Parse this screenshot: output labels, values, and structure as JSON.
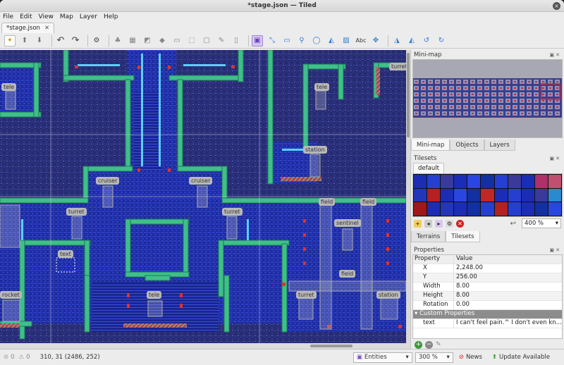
{
  "window": {
    "title": "*stage.json — Tiled"
  },
  "menu": [
    "File",
    "Edit",
    "View",
    "Map",
    "Layer",
    "Help"
  ],
  "document_tab": {
    "label": "*stage.json"
  },
  "toolbar_icons": [
    "new-file-icon",
    "open-file-icon",
    "save-file-icon",
    "undo-icon",
    "redo-icon",
    "command-icon",
    "stamp-brush-icon",
    "terrain-brush-icon",
    "bucket-fill-icon",
    "shape-fill-icon",
    "eraser-icon",
    "rectangle-select-icon",
    "magic-wand-icon",
    "select-same-tile-icon",
    "select-objects-icon",
    "edit-polygons-icon",
    "insert-rectangle-icon",
    "insert-point-icon",
    "insert-ellipse-icon",
    "insert-polygon-icon",
    "insert-tile-icon",
    "insert-text-icon",
    "move-icon",
    "flip-horizontal-icon",
    "flip-vertical-icon",
    "rotate-left-icon",
    "rotate-right-icon"
  ],
  "objects": [
    {
      "label": "tele"
    },
    {
      "label": "tele"
    },
    {
      "label": "turret"
    },
    {
      "label": "station"
    },
    {
      "label": "cruiser"
    },
    {
      "label": "cruiser"
    },
    {
      "label": "turret"
    },
    {
      "label": "turret"
    },
    {
      "label": "field"
    },
    {
      "label": "field"
    },
    {
      "label": "sentinel"
    },
    {
      "label": "text"
    },
    {
      "label": "field"
    },
    {
      "label": "rocket"
    },
    {
      "label": "tele"
    },
    {
      "label": "turret"
    },
    {
      "label": "station"
    }
  ],
  "panels": {
    "minimap": {
      "title": "Mini-map"
    },
    "dock_tabs": [
      "Mini-map",
      "Objects",
      "Layers"
    ],
    "tilesets": {
      "title": "Tilesets",
      "tab": "default",
      "zoom": "400 %"
    },
    "dock_tabs2": [
      "Terrains",
      "Tilesets"
    ],
    "properties": {
      "title": "Properties",
      "header": {
        "k": "Property",
        "v": "Value"
      },
      "rows": [
        {
          "k": "X",
          "v": "2,248.00"
        },
        {
          "k": "Y",
          "v": "256.00"
        },
        {
          "k": "Width",
          "v": "8.00"
        },
        {
          "k": "Height",
          "v": "8.00"
        },
        {
          "k": "Rotation",
          "v": "0.00"
        }
      ],
      "custom_group": "Custom Properties",
      "custom_rows": [
        {
          "k": "text",
          "v": "I can't feel pain.^ I don't even kn..."
        }
      ]
    }
  },
  "status": {
    "errors": "0",
    "warnings": "0",
    "coords": "310, 31 (2486, 252)",
    "layer": "Entities",
    "zoom": "300 %",
    "news": "News",
    "update": "Update Available"
  },
  "colors": {
    "map_bg": "#262a6e",
    "wall_green": "#3fbf8a",
    "accent_red": "#d03030",
    "selected_tool": "#d6c8f0"
  }
}
